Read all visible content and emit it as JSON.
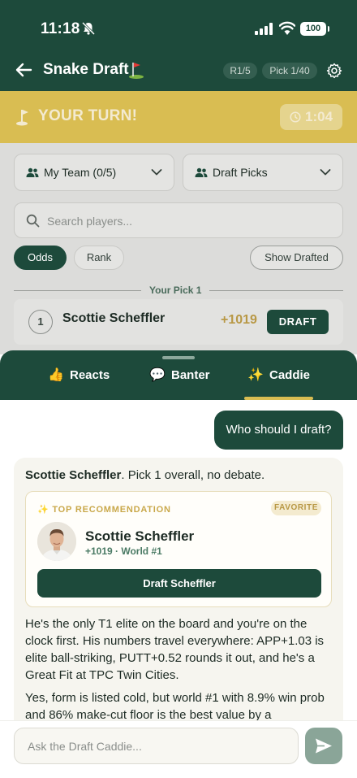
{
  "status_bar": {
    "time": "11:18",
    "battery": "100"
  },
  "header": {
    "title": "Snake Draft",
    "round": "R1/5",
    "pick": "Pick 1/40"
  },
  "turn_banner": {
    "text": "YOUR TURN!",
    "timer": "1:04"
  },
  "filters": {
    "my_team": "My Team (0/5)",
    "draft_picks": "Draft Picks"
  },
  "search": {
    "placeholder": "Search players..."
  },
  "chips": {
    "odds": "Odds",
    "rank": "Rank",
    "show_drafted": "Show Drafted"
  },
  "pick_section": {
    "label": "Your Pick 1",
    "rows": [
      {
        "number": "1",
        "name": "Scottie Scheffler",
        "odds": "+1019",
        "action": "DRAFT"
      }
    ]
  },
  "tabs": [
    {
      "emoji": "👍",
      "label": "Reacts"
    },
    {
      "emoji": "💬",
      "label": "Banter"
    },
    {
      "emoji": "✨",
      "label": "Caddie"
    }
  ],
  "chat": {
    "user_message": "Who should I draft?",
    "ai": {
      "intro_name": "Scottie Scheffler",
      "intro_rest": ". Pick 1 overall, no debate.",
      "recommendation": {
        "label": "✨ TOP RECOMMENDATION",
        "badge": "FAVORITE",
        "name": "Scottie Scheffler",
        "subline": "+1019 · World #1",
        "cta": "Draft Scheffler"
      },
      "paragraph1": "He's the only T1 elite on the board and you're on the clock first. His numbers travel everywhere: APP+1.03 is elite ball-striking, PUTT+0.52 rounds it out, and he's a Great Fit at TPC Twin Cities.",
      "paragraph2": "Yes, form is listed cold, but world #1 with 8.9% win prob and 86% make-cut floor is the best value by a"
    }
  },
  "input": {
    "placeholder": "Ask the Draft Caddie..."
  },
  "colors": {
    "brand_green": "#1d4a3b",
    "accent_gold": "#d9bd52",
    "odds_gold": "#b89845"
  }
}
